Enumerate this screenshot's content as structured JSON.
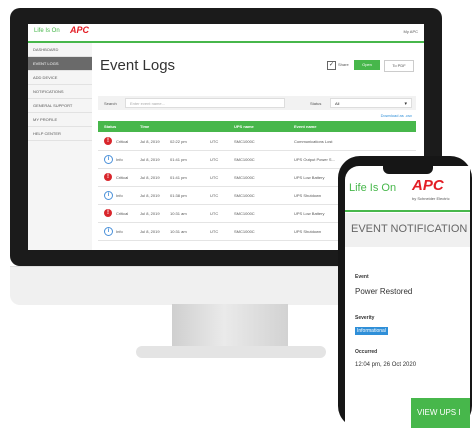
{
  "desktop": {
    "brand": {
      "tagline": "Life Is On",
      "logo": "APC"
    },
    "account": "My APC",
    "sidebar": {
      "items": [
        {
          "label": "Dashboard",
          "active": false
        },
        {
          "label": "Event Logs",
          "active": true
        },
        {
          "label": "Add Device",
          "active": false
        },
        {
          "label": "Notifications",
          "active": false
        },
        {
          "label": "General Support",
          "active": false
        },
        {
          "label": "My Profile",
          "active": false
        },
        {
          "label": "Help Center",
          "active": false
        }
      ]
    },
    "page_title": "Event Logs",
    "toolbar": {
      "check_label": "Share",
      "open_label": "Open",
      "pdf_label": "To PDF"
    },
    "filter": {
      "search_label": "Search",
      "search_placeholder": "Enter event name...",
      "severity_label": "Status",
      "severity_value": "All"
    },
    "download_link": "Download as .csv",
    "table": {
      "headers": [
        "Status",
        "Time",
        "UPS name",
        "Event name"
      ],
      "rows": [
        {
          "status": "critical",
          "status_label": "Critical",
          "date": "Jul 8, 2019",
          "time": "02:22 pm",
          "tz": "UTC",
          "ups": "SMC1000C",
          "event": "Communications Lost"
        },
        {
          "status": "info",
          "status_label": "Info",
          "date": "Jul 8, 2019",
          "time": "01:41 pm",
          "tz": "UTC",
          "ups": "SMC1000C",
          "event": "UPS Output Power S..."
        },
        {
          "status": "critical",
          "status_label": "Critical",
          "date": "Jul 8, 2019",
          "time": "01:41 pm",
          "tz": "UTC",
          "ups": "SMC1000C",
          "event": "UPS Low Battery"
        },
        {
          "status": "info",
          "status_label": "Info",
          "date": "Jul 8, 2019",
          "time": "01:38 pm",
          "tz": "UTC",
          "ups": "SMC1000C",
          "event": "UPS Shutdown"
        },
        {
          "status": "critical",
          "status_label": "Critical",
          "date": "Jul 8, 2019",
          "time": "10:31 am",
          "tz": "UTC",
          "ups": "SMC1000C",
          "event": "UPS Low Battery"
        },
        {
          "status": "info",
          "status_label": "Info",
          "date": "Jul 8, 2019",
          "time": "10:31 am",
          "tz": "UTC",
          "ups": "SMC1000C",
          "event": "UPS Shutdown"
        }
      ]
    }
  },
  "phone": {
    "tagline": "Life Is On",
    "logo": "APC",
    "by": "by Schneider Electric",
    "banner_title": "EVENT NOTIFICATION",
    "event_label": "Event",
    "event_value": "Power Restored",
    "severity_label": "Severity",
    "severity_value": "Informational",
    "occurred_label": "Occurred",
    "occurred_value": "12:04 pm, 26 Oct 2020",
    "button_label": "VIEW UPS I"
  },
  "colors": {
    "brand_green": "#47b74b",
    "brand_red": "#e31d25",
    "info_blue": "#4a90d9"
  }
}
